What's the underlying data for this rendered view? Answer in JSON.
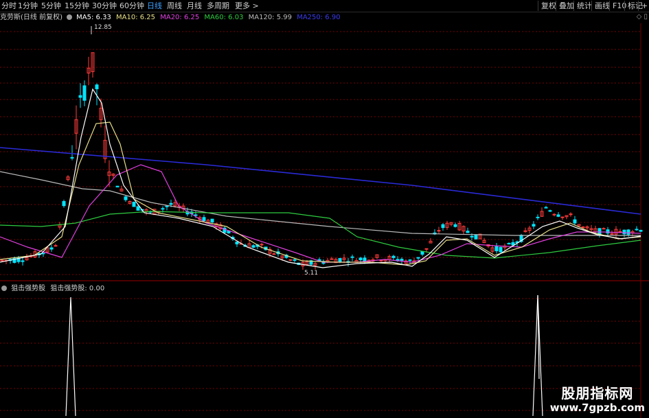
{
  "toolbar": {
    "periods": [
      "分时",
      "1分钟",
      "5分钟",
      "15分钟",
      "30分钟",
      "60分钟",
      "日线",
      "周线",
      "月线",
      "多周期",
      "更多 >"
    ],
    "active_period": "日线",
    "buttons": [
      "复权",
      "叠加",
      "统计",
      "画线",
      "F10",
      "标记",
      "+自"
    ]
  },
  "main_legend": {
    "stock": "克劳斯(日线 前复权)",
    "ma5": "MA5: 6.33",
    "ma10": "MA10: 6.25",
    "ma20": "MA20: 6.25",
    "ma60": "MA60: 6.03",
    "ma120": "MA120: 5.99",
    "ma250": "MA250: 6.90"
  },
  "indicator_legend": {
    "name": "狙击强势股",
    "value": "狙击强势股: 0.00"
  },
  "annotations": {
    "high": "12.85",
    "low": "5.11"
  },
  "watermark": {
    "title": "股朋指标网",
    "url": "www.7gpzb.com"
  },
  "colors": {
    "up": "#ff3b3b",
    "down": "#00e5ff",
    "ma5": "#ffffff",
    "ma10": "#e8e08a",
    "ma20": "#e040e0",
    "ma60": "#2ecc40",
    "ma120": "#bbbbbb",
    "ma250": "#2a2ad8",
    "grid": "#7a0000",
    "active_tab": "#3ea0ff"
  },
  "icons": [
    "circle-icon",
    "diamond-icon",
    "square-icon"
  ],
  "chart_data": {
    "type": "line",
    "price_range": [
      5.11,
      12.85
    ],
    "notes_visible": [
      "12.85",
      "5.11"
    ],
    "indicator_series": {
      "name": "狙击强势股",
      "signal_values": [
        0,
        1,
        0,
        1,
        0
      ],
      "current": 0.0
    }
  }
}
